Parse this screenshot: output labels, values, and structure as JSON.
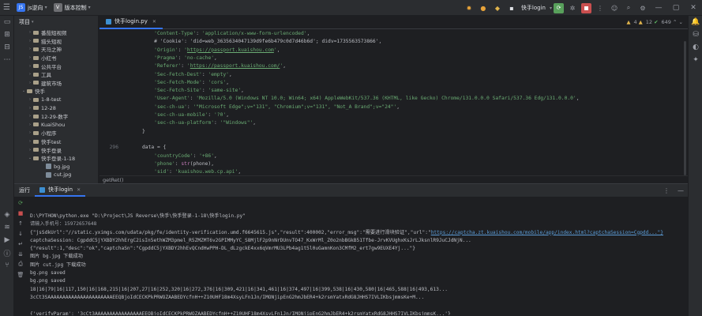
{
  "titlebar": {
    "project_badge": "JS",
    "project_name": "js逆向",
    "vcs_badge": "V",
    "vcs_name": "版本控制",
    "run_config": "快手login",
    "window_controls": [
      "—",
      "▢",
      "✕"
    ]
  },
  "project": {
    "header": "项目",
    "items": [
      {
        "label": "番茄短视频",
        "kind": "folder",
        "indent": 2,
        "arrow": "›"
      },
      {
        "label": "猎头短视",
        "kind": "folder",
        "indent": 2,
        "arrow": "›"
      },
      {
        "label": "天马之神",
        "kind": "folder",
        "indent": 2,
        "arrow": "›"
      },
      {
        "label": "小红书",
        "kind": "folder",
        "indent": 2,
        "arrow": "›"
      },
      {
        "label": "公共平台",
        "kind": "folder",
        "indent": 2,
        "arrow": "›"
      },
      {
        "label": "工具",
        "kind": "folder",
        "indent": 2,
        "arrow": "›"
      },
      {
        "label": "建筑市场",
        "kind": "folder",
        "indent": 2,
        "arrow": "›"
      },
      {
        "label": "快手",
        "kind": "folder",
        "indent": 1,
        "arrow": "⌄"
      },
      {
        "label": "1-8-test",
        "kind": "folder",
        "indent": 2,
        "arrow": "›"
      },
      {
        "label": "12-28",
        "kind": "folder",
        "indent": 2,
        "arrow": "›"
      },
      {
        "label": "12-29-数字",
        "kind": "folder",
        "indent": 2,
        "arrow": "›"
      },
      {
        "label": "KuaiShou",
        "kind": "folder",
        "indent": 2,
        "arrow": "›"
      },
      {
        "label": "小程序",
        "kind": "folder",
        "indent": 2,
        "arrow": "›"
      },
      {
        "label": "快手test",
        "kind": "folder",
        "indent": 2,
        "arrow": "›"
      },
      {
        "label": "快手登录",
        "kind": "folder",
        "indent": 2,
        "arrow": "›"
      },
      {
        "label": "快手登录-1-18",
        "kind": "folder",
        "indent": 2,
        "arrow": "⌄"
      },
      {
        "label": "bg.jpg",
        "kind": "jpg",
        "indent": 4,
        "arrow": ""
      },
      {
        "label": "cut.jpg",
        "kind": "jpg",
        "indent": 4,
        "arrow": ""
      }
    ]
  },
  "editor": {
    "tab": "快手login.py",
    "warnings": "4",
    "weak_warnings": "12",
    "typos": "649",
    "breadcrumb": "getRet()",
    "lines": [
      {
        "n": "",
        "html": "    <span class='s'>'Content-Type'</span>: <span class='s'>'application/x-www-form-urlencoded'</span>,"
      },
      {
        "n": "",
        "html": "    <span class='p'># 'Cookie': 'did=web_3635634047139d9fe6b479c0d7d46b6d'; didv=1735563573866',</span>"
      },
      {
        "n": "",
        "html": "    <span class='s'>'Origin'</span>: <span class='s'>'</span><span class='u'>https://passport.kuaishou.com</span><span class='s'>'</span>,"
      },
      {
        "n": "",
        "html": "    <span class='s'>'Pragma'</span>: <span class='s'>'no-cache'</span>,"
      },
      {
        "n": "",
        "html": "    <span class='s'>'Referer'</span>: <span class='s'>'</span><span class='u'>https://passport.kuaishou.com/</span><span class='s'>'</span>,"
      },
      {
        "n": "",
        "html": "    <span class='s'>'Sec-Fetch-Dest'</span>: <span class='s'>'empty'</span>,"
      },
      {
        "n": "",
        "html": "    <span class='s'>'Sec-Fetch-Mode'</span>: <span class='s'>'cors'</span>,"
      },
      {
        "n": "",
        "html": "    <span class='s'>'Sec-Fetch-Site'</span>: <span class='s'>'same-site'</span>,"
      },
      {
        "n": "",
        "html": "    <span class='s'>'User-Agent'</span>: <span class='s'>'Mozilla/5.0 (Windows NT 10.0; Win64; x64) AppleWebKit/537.36 (KHTML, like Gecko) Chrome/131.0.0.0 Safari/537.36 Edg/131.0.0.0'</span>,"
      },
      {
        "n": "",
        "html": "    <span class='s'>'sec-ch-ua'</span>: <span class='s'>'\"Microsoft Edge\";v=\"131\", \"Chromium\";v=\"131\", \"Not_A Brand\";v=\"24\"'</span>,"
      },
      {
        "n": "",
        "html": "    <span class='s'>'sec-ch-ua-mobile'</span>: <span class='s'>'?0'</span>,"
      },
      {
        "n": "",
        "html": "    <span class='s'>'sec-ch-ua-platform'</span>: <span class='s'>'\"Windows\"'</span>,"
      },
      {
        "n": "",
        "html": "}"
      },
      {
        "n": "",
        "html": ""
      },
      {
        "n": "296",
        "html": "data = {"
      },
      {
        "n": "",
        "html": "    <span class='s'>'countryCode'</span>: <span class='s'>'+86'</span>,"
      },
      {
        "n": "",
        "html": "    <span class='s'>'phone'</span>: <span class='k'>str</span>(phone),"
      },
      {
        "n": "",
        "html": "    <span class='s'>'sid'</span>: <span class='s'>'kuaishou.web.cp.api'</span>,"
      }
    ]
  },
  "run": {
    "label": "运行",
    "tab": "快手login",
    "console": [
      {
        "text": "D:\\PYTHON\\python.exe \"D:\\Project\\JS Reverse\\快手\\快手登录-1-18\\快手login.py\"",
        "cls": ""
      },
      {
        "text": "请输入手机号：15972657648",
        "cls": "dim"
      },
      {
        "text": "{\"jsSdkUrl\":\"//static.yximgs.com/udata/pkg/fe/identity-verification.umd.f6645615.js\",\"result\":400002,\"error_msg\":\"需要进行滑块验证\",\"url\":\"https://captcha.zt.kuaishou.com/mobile/app/index.html?captchaSession=Cgpdd...\"}",
        "cls": "",
        "link_start": 118
      },
      {
        "text": "captchaSession: CgpddC5jYXBDY2hhErgC2isIn5ethWZM3pmel_R5ZMZMT6v2GPIMMyYC_S8MjlF2p9nNrDUnvTO47_KxWrMl_Z0o2nbBGkB51Tfbe-JrvKVUghxKsJrLJksnlR9JuCJdNjN...",
        "cls": ""
      },
      {
        "text": "{\"result\":1,\"desc\":\"ok\",\"captchaSn\":\"CgpddC5jYXBDY2hhEvQCndHwPPH-DL_dLzgckE4xx6qVmrMU3LPb4ag1t5l0uGamnKon3CMfM2_ert7gw9EUXE4Yj...\"}",
        "cls": ""
      },
      {
        "text": "图片 bg.jpg 下载成功",
        "cls": ""
      },
      {
        "text": "图片 cut.jpg 下载成功",
        "cls": ""
      },
      {
        "text": "bg.png saved",
        "cls": ""
      },
      {
        "text": "bg.png saved",
        "cls": ""
      },
      {
        "text": "18|16|79|16|117,150|16|168,215|16|207,27|16|252,320|16|272,376|16|309,421|16|341,461|16|374,497|16|399,538|16|430,580|16|465,588|16|493,613...",
        "cls": ""
      },
      {
        "text": "3cCt3SAAAAAAAAAAAAAAAAAAAAAAEEQBjoIdCECKPkPRWOZAABEDYcfnH++Z10UHF18m4XsyLFn1Jn/IMONjipEnG2hmJbER4+k2rsmYatxRdG8JHHS7IVLIKbsjmmsKe+M...",
        "cls": ""
      },
      {
        "text": "",
        "cls": ""
      },
      {
        "text": "{'verifyParam': '3cCt3AAAAAAAAAAAAAAAAEEQBjoIdCECKPkPRWOZAABEDYcfnH++Z10UHF18m4XsyLFn1Jn/IMONjipEnG2hmJbER4+k2rsmYatxRdG8JHHS7IVLIKbsjmmsK...'}",
        "cls": ""
      }
    ]
  },
  "colors": {
    "accent": "#3574f0",
    "run_green": "#58a05b",
    "stop_red": "#c94f4f",
    "string_green": "#6aab73"
  }
}
